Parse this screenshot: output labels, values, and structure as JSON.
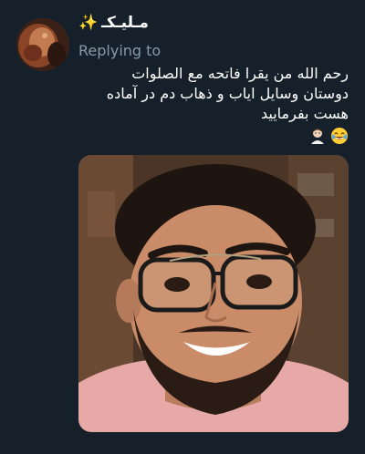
{
  "tweet": {
    "author_name": "مـلیـکـ",
    "author_badge_icon": "sparkles-icon",
    "replying_to_label": "Replying to",
    "lines": [
      "رحم الله من یقرا فاتحه مع الصلوات",
      "دوستان وسایل ایاب و ذهاب دم در آماده",
      "هست بفرمایید"
    ],
    "emojis": [
      "face-with-tears-of-joy-icon",
      "person-tipping-hand-icon"
    ]
  },
  "colors": {
    "background": "#15202b",
    "secondary_text": "#8899a6"
  }
}
